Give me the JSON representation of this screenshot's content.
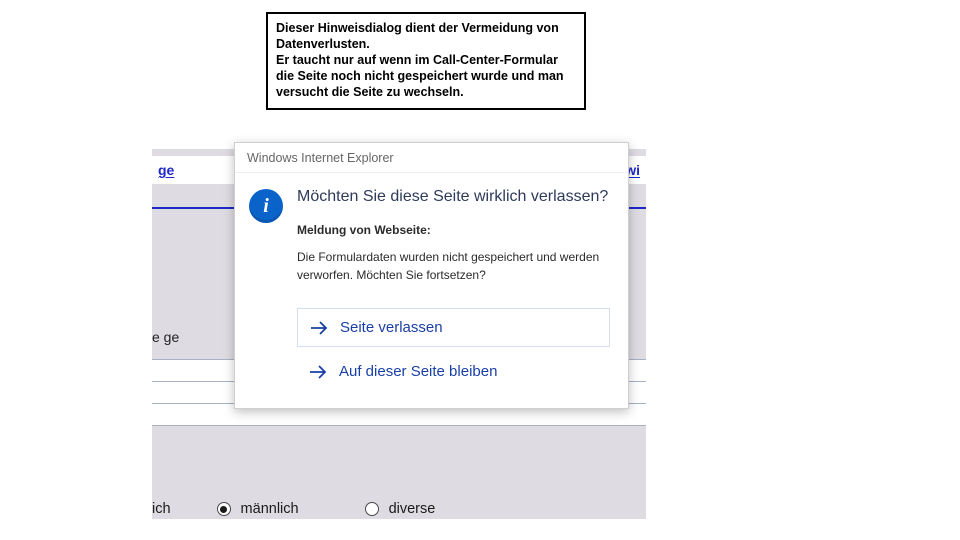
{
  "explain": {
    "line1": "Dieser Hinweisdialog dient der Vermeidung von Datenverlusten.",
    "line2": "Er taucht nur auf wenn im Call-Center-Formular die Seite noch nicht gespeichert wurde und man versucht die Seite zu wechseln."
  },
  "background_form": {
    "link_left": "ge",
    "link_right": "freiwi",
    "section_hint_left": "e ge",
    "label_left": "ich",
    "radios": {
      "option1": {
        "label": "männlich",
        "checked": true
      },
      "option2": {
        "label": "diverse",
        "checked": false
      }
    }
  },
  "dialog": {
    "window_title": "Windows Internet Explorer",
    "info_glyph": "i",
    "heading": "Möchten Sie diese Seite wirklich verlassen?",
    "subheading": "Meldung von Webseite:",
    "message": "Die Formulardaten wurden nicht gespeichert und werden verworfen. Möchten Sie fortsetzen?",
    "primary_label": "Seite verlassen",
    "secondary_label": "Auf dieser Seite bleiben"
  }
}
